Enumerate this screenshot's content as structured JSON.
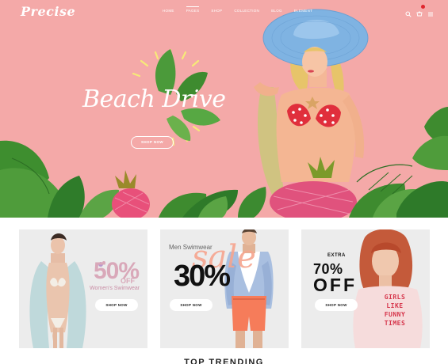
{
  "header": {
    "logo": "Precise",
    "nav": [
      "Home",
      "Pages",
      "Shop",
      "Collection",
      "Blog",
      "Element"
    ],
    "active_nav_index": 1,
    "icons": [
      "search-icon",
      "cart-icon",
      "menu-icon"
    ]
  },
  "hero": {
    "title": "Beach Drive",
    "button": "SHOP NOW"
  },
  "cards": [
    {
      "headline": "50%",
      "off": "OFF",
      "subtitle": "Women's Swimwear",
      "button": "SHOP NOW"
    },
    {
      "kicker": "Men Swimwear",
      "script": "sale",
      "headline": "30%",
      "button": "SHOP NOW"
    },
    {
      "label": "EXTRA",
      "headline": "70%",
      "off": "OFF",
      "shirt_text": [
        "GIRLS",
        "LIKE",
        "FUNNY",
        "TIMES"
      ],
      "button": "SHOP NOW"
    }
  ],
  "section": {
    "title": "TOP TRENDING"
  },
  "colors": {
    "hero_bg": "#f4a9a8",
    "card_bg": "#ececec",
    "accent": "#e0262e"
  }
}
